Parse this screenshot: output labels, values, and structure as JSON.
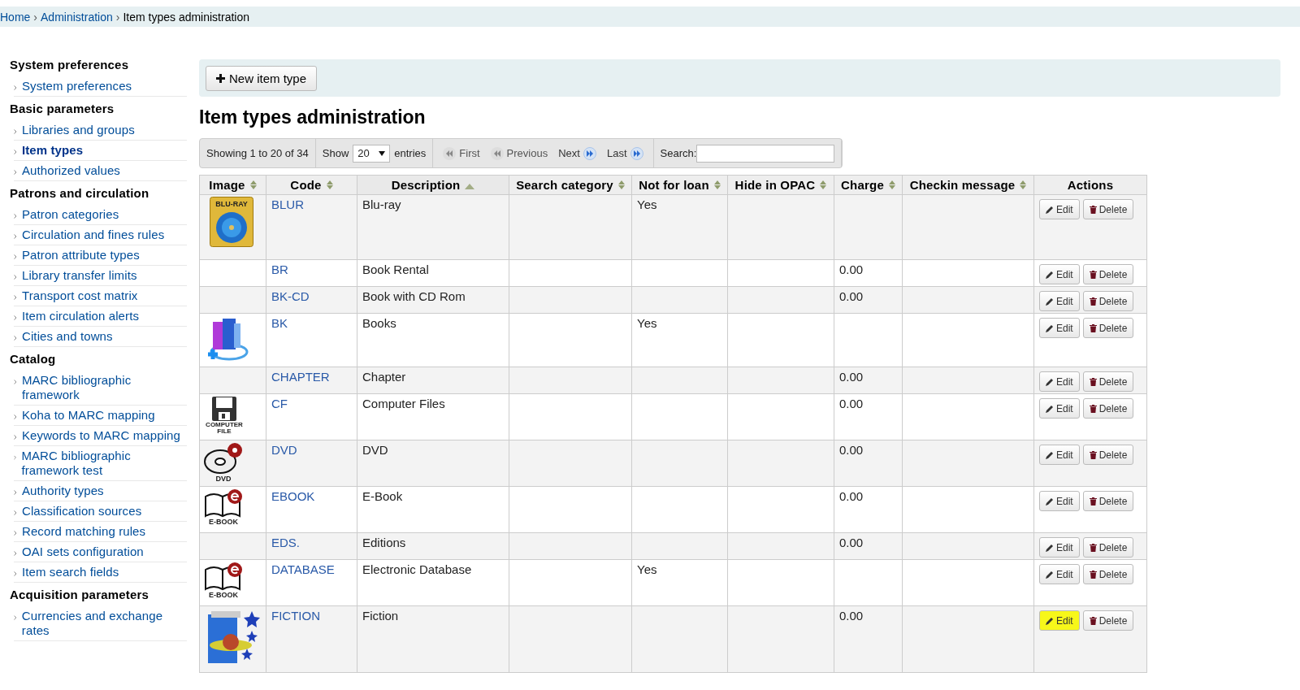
{
  "breadcrumbs": [
    {
      "label": "Home",
      "link": true
    },
    {
      "label": "Administration",
      "link": true
    },
    {
      "label": "Item types administration",
      "link": false
    }
  ],
  "breadcrumb_separator": "›",
  "sidebar": [
    {
      "heading": "System preferences",
      "items": [
        {
          "label": "System preferences",
          "selected": false
        }
      ]
    },
    {
      "heading": "Basic parameters",
      "items": [
        {
          "label": "Libraries and groups",
          "selected": false
        },
        {
          "label": "Item types",
          "selected": true
        },
        {
          "label": "Authorized values",
          "selected": false
        }
      ]
    },
    {
      "heading": "Patrons and circulation",
      "items": [
        {
          "label": "Patron categories",
          "selected": false
        },
        {
          "label": "Circulation and fines rules",
          "selected": false
        },
        {
          "label": "Patron attribute types",
          "selected": false
        },
        {
          "label": "Library transfer limits",
          "selected": false
        },
        {
          "label": "Transport cost matrix",
          "selected": false
        },
        {
          "label": "Item circulation alerts",
          "selected": false
        },
        {
          "label": "Cities and towns",
          "selected": false
        }
      ]
    },
    {
      "heading": "Catalog",
      "items": [
        {
          "label": "MARC bibliographic framework",
          "selected": false
        },
        {
          "label": "Koha to MARC mapping",
          "selected": false
        },
        {
          "label": "Keywords to MARC mapping",
          "selected": false
        },
        {
          "label": "MARC bibliographic framework test",
          "selected": false
        },
        {
          "label": "Authority types",
          "selected": false
        },
        {
          "label": "Classification sources",
          "selected": false
        },
        {
          "label": "Record matching rules",
          "selected": false
        },
        {
          "label": "OAI sets configuration",
          "selected": false
        },
        {
          "label": "Item search fields",
          "selected": false
        }
      ]
    },
    {
      "heading": "Acquisition parameters",
      "items": [
        {
          "label": "Currencies and exchange rates",
          "selected": false
        }
      ]
    }
  ],
  "toolbar": {
    "new_button": "New item type"
  },
  "title": "Item types administration",
  "controls": {
    "info": "Showing 1 to 20 of 34",
    "show_label": "Show",
    "page_size": "20",
    "entries_label": "entries",
    "pager": [
      {
        "label": "First",
        "kind": "first",
        "disabled": true
      },
      {
        "label": "Previous",
        "kind": "previous",
        "disabled": true
      },
      {
        "label": "Next",
        "kind": "next",
        "disabled": false
      },
      {
        "label": "Last",
        "kind": "last",
        "disabled": false
      }
    ],
    "search_label": "Search:"
  },
  "table": {
    "columns": [
      {
        "label": "Image",
        "sortable": true,
        "sorted_ascending": false
      },
      {
        "label": "Code",
        "sortable": true,
        "sorted_ascending": false
      },
      {
        "label": "Description",
        "sortable": true,
        "sorted_ascending": true
      },
      {
        "label": "Search category",
        "sortable": true,
        "sorted_ascending": false
      },
      {
        "label": "Not for loan",
        "sortable": true,
        "sorted_ascending": false
      },
      {
        "label": "Hide in OPAC",
        "sortable": true,
        "sorted_ascending": false
      },
      {
        "label": "Charge",
        "sortable": true,
        "sorted_ascending": false
      },
      {
        "label": "Checkin message",
        "sortable": true,
        "sorted_ascending": false
      },
      {
        "label": "Actions",
        "sortable": false
      }
    ],
    "rows": [
      {
        "image": {
          "kind": "bluray",
          "caption": "BLU-RAY"
        },
        "code": "BLUR",
        "description": "Blu-ray",
        "not_for_loan": "Yes",
        "charge": "",
        "edit_label": "Edit",
        "delete_label": "Delete",
        "edit_highlighted": false
      },
      {
        "code": "BR",
        "description": "Book Rental",
        "not_for_loan": "",
        "charge": "0.00",
        "edit_label": "Edit",
        "delete_label": "Delete",
        "edit_highlighted": false
      },
      {
        "code": "BK-CD",
        "description": "Book with CD Rom",
        "not_for_loan": "",
        "charge": "0.00",
        "edit_label": "Edit",
        "delete_label": "Delete",
        "edit_highlighted": false
      },
      {
        "image": {
          "kind": "books"
        },
        "code": "BK",
        "description": "Books",
        "not_for_loan": "Yes",
        "charge": "",
        "edit_label": "Edit",
        "delete_label": "Delete",
        "edit_highlighted": false
      },
      {
        "code": "CHAPTER",
        "description": "Chapter",
        "not_for_loan": "",
        "charge": "0.00",
        "edit_label": "Edit",
        "delete_label": "Delete",
        "edit_highlighted": false
      },
      {
        "image": {
          "kind": "floppy",
          "caption": "COMPUTER FILE"
        },
        "code": "CF",
        "description": "Computer Files",
        "not_for_loan": "",
        "charge": "0.00",
        "edit_label": "Edit",
        "delete_label": "Delete",
        "edit_highlighted": false
      },
      {
        "image": {
          "kind": "dvd",
          "caption": "DVD"
        },
        "code": "DVD",
        "description": "DVD",
        "not_for_loan": "",
        "charge": "0.00",
        "edit_label": "Edit",
        "delete_label": "Delete",
        "edit_highlighted": false
      },
      {
        "image": {
          "kind": "ebook",
          "caption": "E-BOOK"
        },
        "code": "EBOOK",
        "description": "E-Book",
        "not_for_loan": "",
        "charge": "0.00",
        "edit_label": "Edit",
        "delete_label": "Delete",
        "edit_highlighted": false
      },
      {
        "code": "EDS.",
        "description": "Editions",
        "not_for_loan": "",
        "charge": "0.00",
        "edit_label": "Edit",
        "delete_label": "Delete",
        "edit_highlighted": false
      },
      {
        "image": {
          "kind": "ebook",
          "caption": "E-BOOK"
        },
        "code": "DATABASE",
        "description": "Electronic Database",
        "not_for_loan": "Yes",
        "charge": "",
        "edit_label": "Edit",
        "delete_label": "Delete",
        "edit_highlighted": false
      },
      {
        "image": {
          "kind": "fiction"
        },
        "code": "FICTION",
        "description": "Fiction",
        "not_for_loan": "",
        "charge": "0.00",
        "edit_label": "Edit",
        "delete_label": "Delete",
        "edit_highlighted": true
      }
    ]
  }
}
